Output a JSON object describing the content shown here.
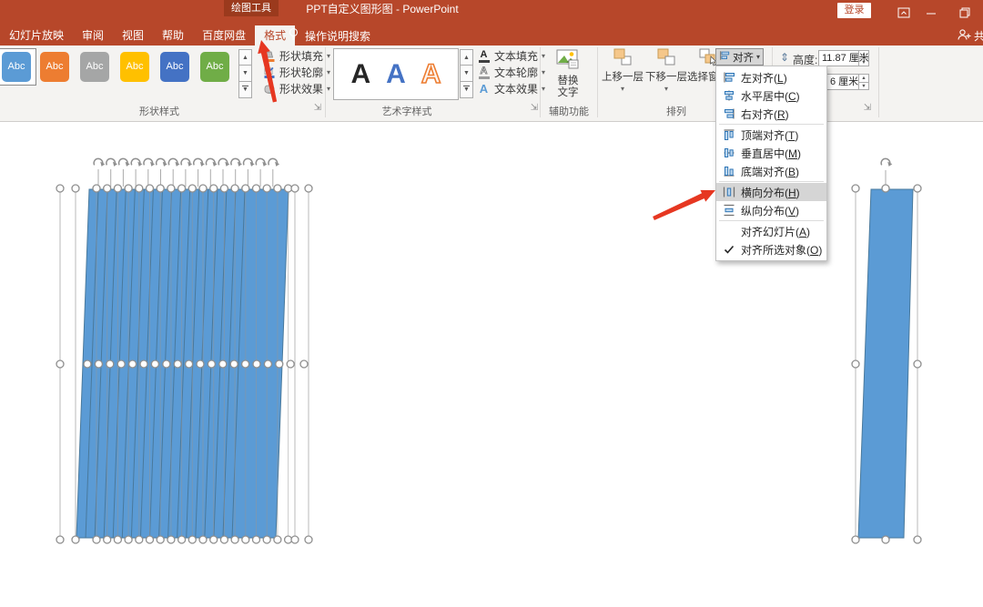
{
  "titlebar": {
    "contextual_tab": "绘图工具",
    "title": "PPT自定义图形图  -  PowerPoint",
    "sign_in": "登录"
  },
  "tabs": [
    {
      "name": "slideshow",
      "label": "幻灯片放映"
    },
    {
      "name": "review",
      "label": "审阅"
    },
    {
      "name": "view",
      "label": "视图"
    },
    {
      "name": "help",
      "label": "帮助"
    },
    {
      "name": "baidu-netdisk",
      "label": "百度网盘"
    },
    {
      "name": "format",
      "label": "格式",
      "active": true
    }
  ],
  "tellme": {
    "label": "操作说明搜索"
  },
  "share": {
    "label": "共享"
  },
  "ribbon": {
    "shape_styles": {
      "group_label": "形状样式",
      "gallery": [
        {
          "name": "shape-style-blue-selected",
          "label": "Abc",
          "color": "#5B9BD5",
          "selected": true
        },
        {
          "name": "shape-style-orange",
          "label": "Abc",
          "color": "#ED7D31"
        },
        {
          "name": "shape-style-gray",
          "label": "Abc",
          "color": "#A5A6A6"
        },
        {
          "name": "shape-style-yellow",
          "label": "Abc",
          "color": "#FFC000"
        },
        {
          "name": "shape-style-darkblue",
          "label": "Abc",
          "color": "#4472C4"
        },
        {
          "name": "shape-style-green",
          "label": "Abc",
          "color": "#70AD47"
        }
      ],
      "buttons": [
        {
          "name": "shape-fill",
          "label": "形状填充"
        },
        {
          "name": "shape-outline",
          "label": "形状轮廓"
        },
        {
          "name": "shape-effects",
          "label": "形状效果"
        }
      ]
    },
    "wordart": {
      "group_label": "艺术字样式",
      "samples": [
        "A",
        "A",
        "A"
      ],
      "buttons": [
        {
          "name": "text-fill",
          "label": "文本填充"
        },
        {
          "name": "text-outline",
          "label": "文本轮廓"
        },
        {
          "name": "text-effects",
          "label": "文本效果"
        }
      ]
    },
    "accessibility": {
      "group_label": "辅助功能",
      "alt_text_button": "替换文字"
    },
    "arrange": {
      "group_label": "排列",
      "bring_forward": "上移一层",
      "send_backward": "下移一层",
      "selection_pane": "选择窗格",
      "align_button": "对齐"
    },
    "size": {
      "height_label": "高度:",
      "height_value": "11.87 厘米",
      "width_value_visible": "6 厘米"
    }
  },
  "align_menu": {
    "items": [
      {
        "name": "align-left",
        "text": "左对齐",
        "key": "L",
        "icon": "align-left"
      },
      {
        "name": "align-center",
        "text": "水平居中",
        "key": "C",
        "icon": "align-center"
      },
      {
        "name": "align-right",
        "text": "右对齐",
        "key": "R",
        "icon": "align-right"
      },
      {
        "sep": true
      },
      {
        "name": "align-top",
        "text": "顶端对齐",
        "key": "T",
        "icon": "align-top"
      },
      {
        "name": "align-middle",
        "text": "垂直居中",
        "key": "M",
        "icon": "align-middle"
      },
      {
        "name": "align-bottom",
        "text": "底端对齐",
        "key": "B",
        "icon": "align-bottom"
      },
      {
        "sep": true
      },
      {
        "name": "distribute-horizontally",
        "text": "横向分布",
        "key": "H",
        "icon": "dist-h",
        "highlighted": true
      },
      {
        "name": "distribute-vertically",
        "text": "纵向分布",
        "key": "V",
        "icon": "dist-v"
      },
      {
        "sep": true
      },
      {
        "name": "align-to-slide",
        "text": "对齐幻灯片",
        "key": "A"
      },
      {
        "name": "align-selected-objects",
        "text": "对齐所选对象",
        "key": "O",
        "checked": true
      }
    ]
  },
  "canvas": {
    "left_group": {
      "shape_count": 18,
      "fill_color": "#5B9BD5",
      "selected": true
    },
    "right_shape": {
      "fill_color": "#5B9BD5",
      "selected": true
    },
    "annotation_color": "#E63721"
  },
  "icons": {
    "lightbulb": "tell-me bulb",
    "person_plus": "share person",
    "rotation_handle": "circular arrow",
    "spinner": "up/down triangles"
  }
}
